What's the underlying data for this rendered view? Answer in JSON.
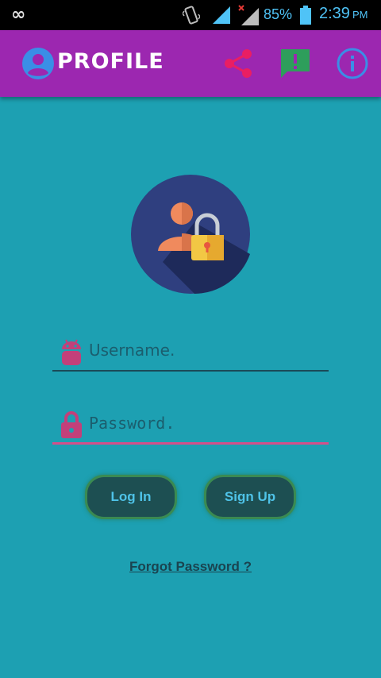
{
  "status_bar": {
    "battery_percent": "85%",
    "time": "2:39",
    "ampm": "PM"
  },
  "app_bar": {
    "title": "PROFILE",
    "icons": [
      "profile-icon",
      "share-icon",
      "feedback-icon",
      "info-icon"
    ]
  },
  "form": {
    "username_placeholder": "Username.",
    "password_placeholder": "Password.",
    "login_label": "Log In",
    "signup_label": "Sign Up",
    "forgot_label": "Forgot Password ?"
  },
  "colors": {
    "background": "#1da0b2",
    "app_bar": "#9c27b0",
    "accent_pink": "#d4508a",
    "button_bg": "#1d4f52"
  }
}
